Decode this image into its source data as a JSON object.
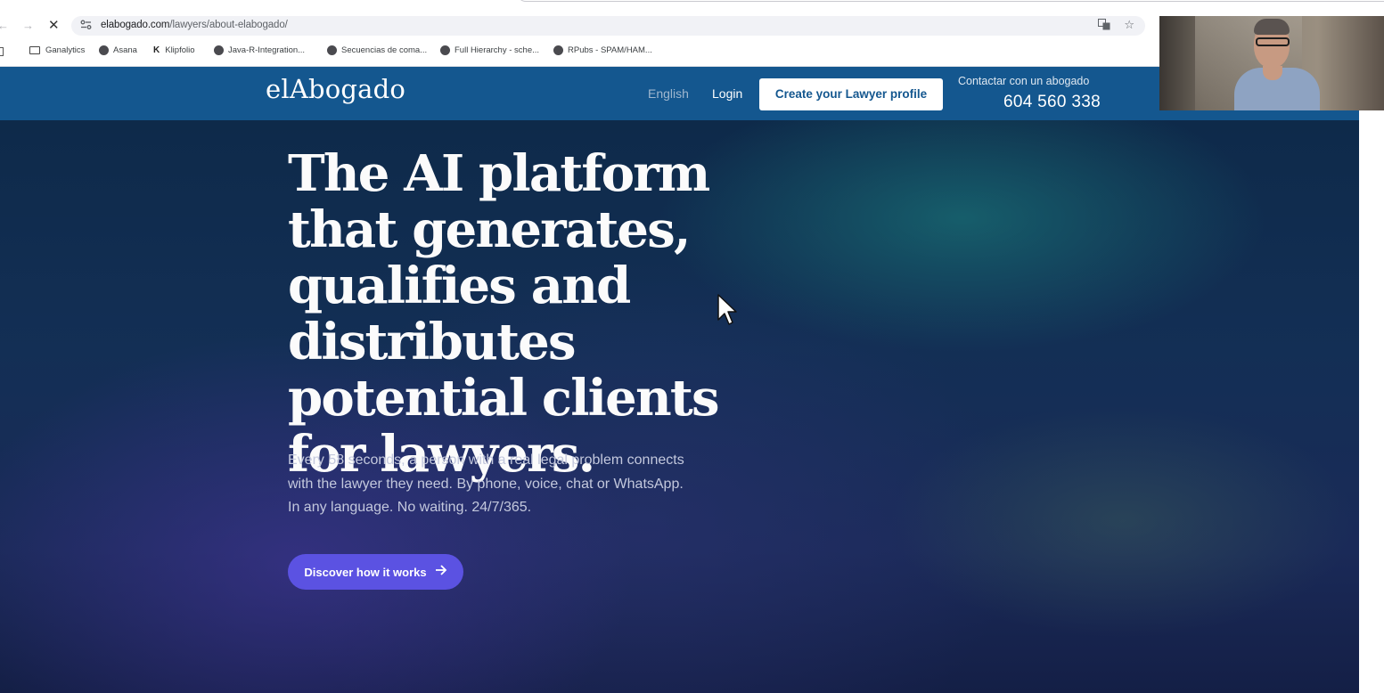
{
  "browser": {
    "url_host": "elabogado.com",
    "url_path": "/lawyers/about-elabogado/",
    "nav": {
      "back": "←",
      "forward": "→",
      "stop": "✕"
    },
    "site_info_icon": "tune-icon",
    "omnibox_icons": [
      "translate-icon",
      "star-icon"
    ],
    "bookmarks": [
      {
        "label": "Ganalytics",
        "icon": "folder-icon"
      },
      {
        "label": "Asana",
        "icon": "globe-icon"
      },
      {
        "label": "Klipfolio",
        "icon": "klipfolio-icon"
      },
      {
        "label": "Java-R-Integration...",
        "icon": "globe-icon"
      },
      {
        "label": "Secuencias de coma...",
        "icon": "globe-icon"
      },
      {
        "label": "Full Hierarchy - sche...",
        "icon": "globe-icon"
      },
      {
        "label": "RPubs - SPAM/HAM...",
        "icon": "globe-icon"
      }
    ]
  },
  "header": {
    "logo": "elAbogado",
    "language": "English",
    "login": "Login",
    "cta": "Create your Lawyer profile",
    "contact_label": "Contactar con un abogado",
    "contact_phone": "604 560 338",
    "brand_color": "#14578f"
  },
  "hero": {
    "title": "The AI platform that generates, qualifies and distributes potential clients for lawyers.",
    "subtitle_lines": [
      "Every 58 seconds, a person with a real legal problem connects",
      "with the lawyer they need. By phone, voice, chat or WhatsApp.",
      "In any language. No waiting. 24/7/365."
    ],
    "button_label": "Discover how it works",
    "button_icon": "arrow-right-icon",
    "button_color": "#5b52e2"
  }
}
